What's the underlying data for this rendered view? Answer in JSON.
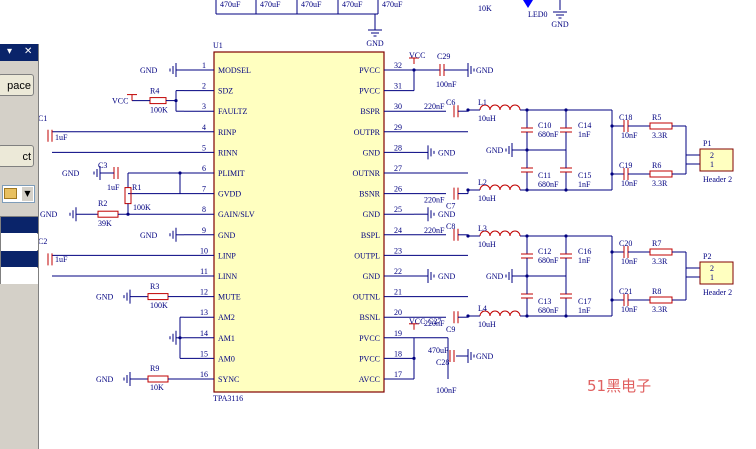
{
  "sidebar": {
    "button1_label": "pace",
    "button2_label": "ct"
  },
  "chip": {
    "ref": "U1",
    "part": "TPA3116",
    "left_pins": [
      {
        "num": "1",
        "name": "MODSEL"
      },
      {
        "num": "2",
        "name": "SDZ"
      },
      {
        "num": "3",
        "name": "FAULTZ"
      },
      {
        "num": "4",
        "name": "RINP"
      },
      {
        "num": "5",
        "name": "RINN"
      },
      {
        "num": "6",
        "name": "PLIMIT"
      },
      {
        "num": "7",
        "name": "GVDD"
      },
      {
        "num": "8",
        "name": "GAIN/SLV"
      },
      {
        "num": "9",
        "name": "GND"
      },
      {
        "num": "10",
        "name": "LINP"
      },
      {
        "num": "11",
        "name": "LINN"
      },
      {
        "num": "12",
        "name": "MUTE"
      },
      {
        "num": "13",
        "name": "AM2"
      },
      {
        "num": "14",
        "name": "AM1"
      },
      {
        "num": "15",
        "name": "AM0"
      },
      {
        "num": "16",
        "name": "SYNC"
      }
    ],
    "right_pins": [
      {
        "num": "32",
        "name": "PVCC"
      },
      {
        "num": "31",
        "name": "PVCC"
      },
      {
        "num": "30",
        "name": "BSPR"
      },
      {
        "num": "29",
        "name": "OUTPR"
      },
      {
        "num": "28",
        "name": "GND"
      },
      {
        "num": "27",
        "name": "OUTNR"
      },
      {
        "num": "26",
        "name": "BSNR"
      },
      {
        "num": "25",
        "name": "GND"
      },
      {
        "num": "24",
        "name": "BSPL"
      },
      {
        "num": "23",
        "name": "OUTPL"
      },
      {
        "num": "22",
        "name": "GND"
      },
      {
        "num": "21",
        "name": "OUTNL"
      },
      {
        "num": "20",
        "name": "BSNL"
      },
      {
        "num": "19",
        "name": "PVCC"
      },
      {
        "num": "18",
        "name": "PVCC"
      },
      {
        "num": "17",
        "name": "AVCC"
      }
    ]
  },
  "nets": {
    "gnd": "GND",
    "vcc": "VCC"
  },
  "top_caps": [
    "470uF",
    "470uF",
    "470uF",
    "470uF",
    "470uF"
  ],
  "top_misc": {
    "r_value": "10K",
    "led_ref": "LED0"
  },
  "components": {
    "R4": {
      "ref": "R4",
      "value": "100K"
    },
    "C1": {
      "ref": "C1",
      "value": "1uF"
    },
    "C3": {
      "ref": "C3",
      "value": "1uF"
    },
    "R1": {
      "ref": "R1",
      "value": "100K"
    },
    "R2": {
      "ref": "R2",
      "value": "39K"
    },
    "C2": {
      "ref": "C2",
      "value": "1uF"
    },
    "R3": {
      "ref": "R3",
      "value": "100K"
    },
    "R9": {
      "ref": "R9",
      "value": "10K"
    },
    "C29": {
      "ref": "C29",
      "value": "100nF"
    },
    "C6": {
      "ref": "C6",
      "value": "220nF"
    },
    "C7": {
      "ref": "C7",
      "value": "220nF"
    },
    "C8": {
      "ref": "C8",
      "value": "220nF"
    },
    "C9": {
      "ref": "C9",
      "value": "220nF"
    },
    "L1": {
      "ref": "L1",
      "value": "10uH"
    },
    "L2": {
      "ref": "L2",
      "value": "10uH"
    },
    "L3": {
      "ref": "L3",
      "value": "10uH"
    },
    "L4": {
      "ref": "L4",
      "value": "10uH"
    },
    "C10": {
      "ref": "C10",
      "value": "680nF"
    },
    "C11": {
      "ref": "C11",
      "value": "680nF"
    },
    "C12": {
      "ref": "C12",
      "value": "680nF"
    },
    "C13": {
      "ref": "C13",
      "value": "680nF"
    },
    "C14": {
      "ref": "C14",
      "value": "1nF"
    },
    "C15": {
      "ref": "C15",
      "value": "1nF"
    },
    "C16": {
      "ref": "C16",
      "value": "1nF"
    },
    "C17": {
      "ref": "C17",
      "value": "1nF"
    },
    "C18": {
      "ref": "C18",
      "value": "10nF"
    },
    "C19": {
      "ref": "C19",
      "value": "10nF"
    },
    "C20": {
      "ref": "C20",
      "value": "10nF"
    },
    "C21": {
      "ref": "C21",
      "value": "10nF"
    },
    "R5": {
      "ref": "R5",
      "value": "3.3R"
    },
    "R6": {
      "ref": "R6",
      "value": "3.3R"
    },
    "R7": {
      "ref": "R7",
      "value": "3.3R"
    },
    "R8": {
      "ref": "R8",
      "value": "3.3R"
    },
    "C27": {
      "ref": "C27",
      "value": "470uF"
    },
    "C28": {
      "ref": "C28",
      "value": "100nF"
    }
  },
  "headers": {
    "P1": {
      "ref": "P1",
      "name": "Header 2",
      "pins": [
        "2",
        "1"
      ]
    },
    "P2": {
      "ref": "P2",
      "name": "Header 2",
      "pins": [
        "2",
        "1"
      ]
    }
  },
  "watermark": "51黑电子",
  "colors": {
    "wire": "#000080",
    "label": "#000080",
    "component": "#c00000",
    "chip_fill": "#ffffc0",
    "chip_border": "#800000",
    "watermark": "#e06060",
    "sidebar": "#d4d0c8",
    "selected_row": "#0a246a",
    "led": "#0000ff"
  },
  "icons": {
    "close": "close-icon",
    "pin": "pin-icon",
    "dropdown": "chevron-down-icon",
    "folder": "folder-icon"
  }
}
